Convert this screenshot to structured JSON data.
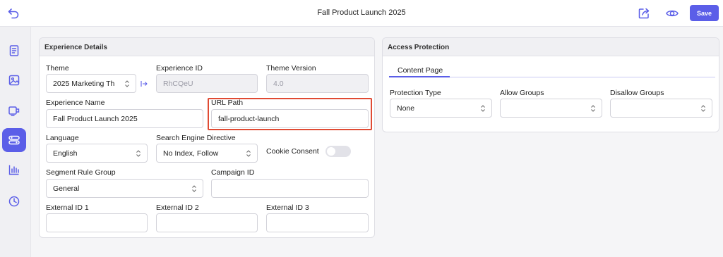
{
  "header": {
    "title": "Fall Product Launch 2025",
    "save_label": "Save"
  },
  "sidebar": {
    "items": [
      {
        "icon": "document-icon",
        "active": false
      },
      {
        "icon": "image-icon",
        "active": false
      },
      {
        "icon": "device-icon",
        "active": false
      },
      {
        "icon": "settings-toggles-icon",
        "active": true
      },
      {
        "icon": "bar-chart-icon",
        "active": false
      },
      {
        "icon": "history-icon",
        "active": false
      }
    ]
  },
  "experience": {
    "section_title": "Experience Details",
    "theme": {
      "label": "Theme",
      "value": "2025 Marketing Th"
    },
    "experience_id": {
      "label": "Experience ID",
      "value": "RhCQeU"
    },
    "theme_version": {
      "label": "Theme Version",
      "value": "4.0"
    },
    "experience_name": {
      "label": "Experience Name",
      "value": "Fall Product Launch 2025"
    },
    "url_path": {
      "label": "URL Path",
      "value": "fall-product-launch"
    },
    "language": {
      "label": "Language",
      "value": "English"
    },
    "search_engine": {
      "label": "Search Engine Directive",
      "value": "No Index, Follow"
    },
    "cookie_consent": {
      "label": "Cookie Consent",
      "enabled": false
    },
    "segment_rule_group": {
      "label": "Segment Rule Group",
      "value": "General"
    },
    "campaign_id": {
      "label": "Campaign ID",
      "value": ""
    },
    "external_id_1": {
      "label": "External ID 1",
      "value": ""
    },
    "external_id_2": {
      "label": "External ID 2",
      "value": ""
    },
    "external_id_3": {
      "label": "External ID 3",
      "value": ""
    }
  },
  "access": {
    "section_title": "Access Protection",
    "tab_label": "Content Page",
    "protection_type": {
      "label": "Protection Type",
      "value": "None"
    },
    "allow_groups": {
      "label": "Allow Groups",
      "value": ""
    },
    "disallow_groups": {
      "label": "Disallow Groups",
      "value": ""
    }
  },
  "colors": {
    "accent": "#5b5ee8",
    "highlight": "#e04a33"
  }
}
